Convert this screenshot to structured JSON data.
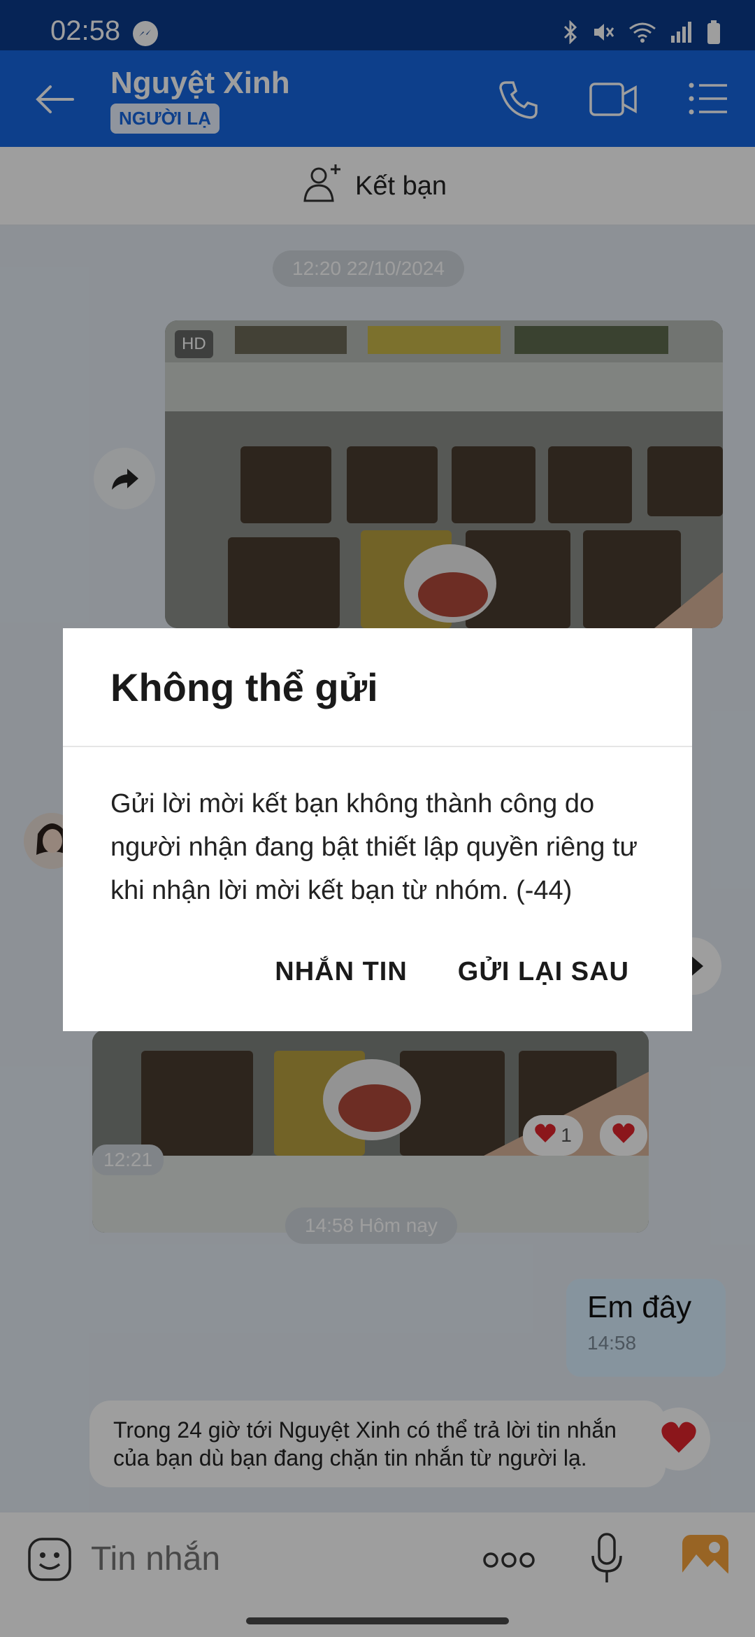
{
  "status_bar": {
    "time": "02:58",
    "icons": [
      "messenger-icon",
      "bluetooth-icon",
      "mute-icon",
      "wifi-icon",
      "signal-icon",
      "battery-icon"
    ]
  },
  "header": {
    "contact_name": "Nguyệt Xinh",
    "badge": "NGƯỜI LẠ",
    "icons": [
      "back-arrow-icon",
      "phone-icon",
      "video-call-icon",
      "menu-list-icon"
    ]
  },
  "add_friend": {
    "label": "Kết bạn"
  },
  "chat": {
    "date_1": "12:20 22/10/2024",
    "hd_label": "HD",
    "reaction_count": "1",
    "photo_time": "12:21",
    "date_2": "14:58 Hôm nay",
    "my_message": {
      "text": "Em đây",
      "time": "14:58"
    },
    "notice": "Trong 24 giờ tới Nguyệt Xinh có thể trả lời tin nhắn của bạn dù bạn đang chặn tin nhắn từ người lạ."
  },
  "input": {
    "placeholder": "Tin nhắn"
  },
  "dialog": {
    "title": "Không thể gửi",
    "body": "Gửi lời mời kết bạn không thành công do người nhận đang bật thiết lập quyền riêng tư khi nhận lời mời kết bạn từ nhóm. (-44)",
    "btn_message": "NHẮN TIN",
    "btn_resend_later": "GỬI LẠI SAU"
  },
  "colors": {
    "header": "#1666e0",
    "status_bar": "#0a3a8c",
    "my_bubble": "#d9efff",
    "heart": "#e0242c"
  }
}
